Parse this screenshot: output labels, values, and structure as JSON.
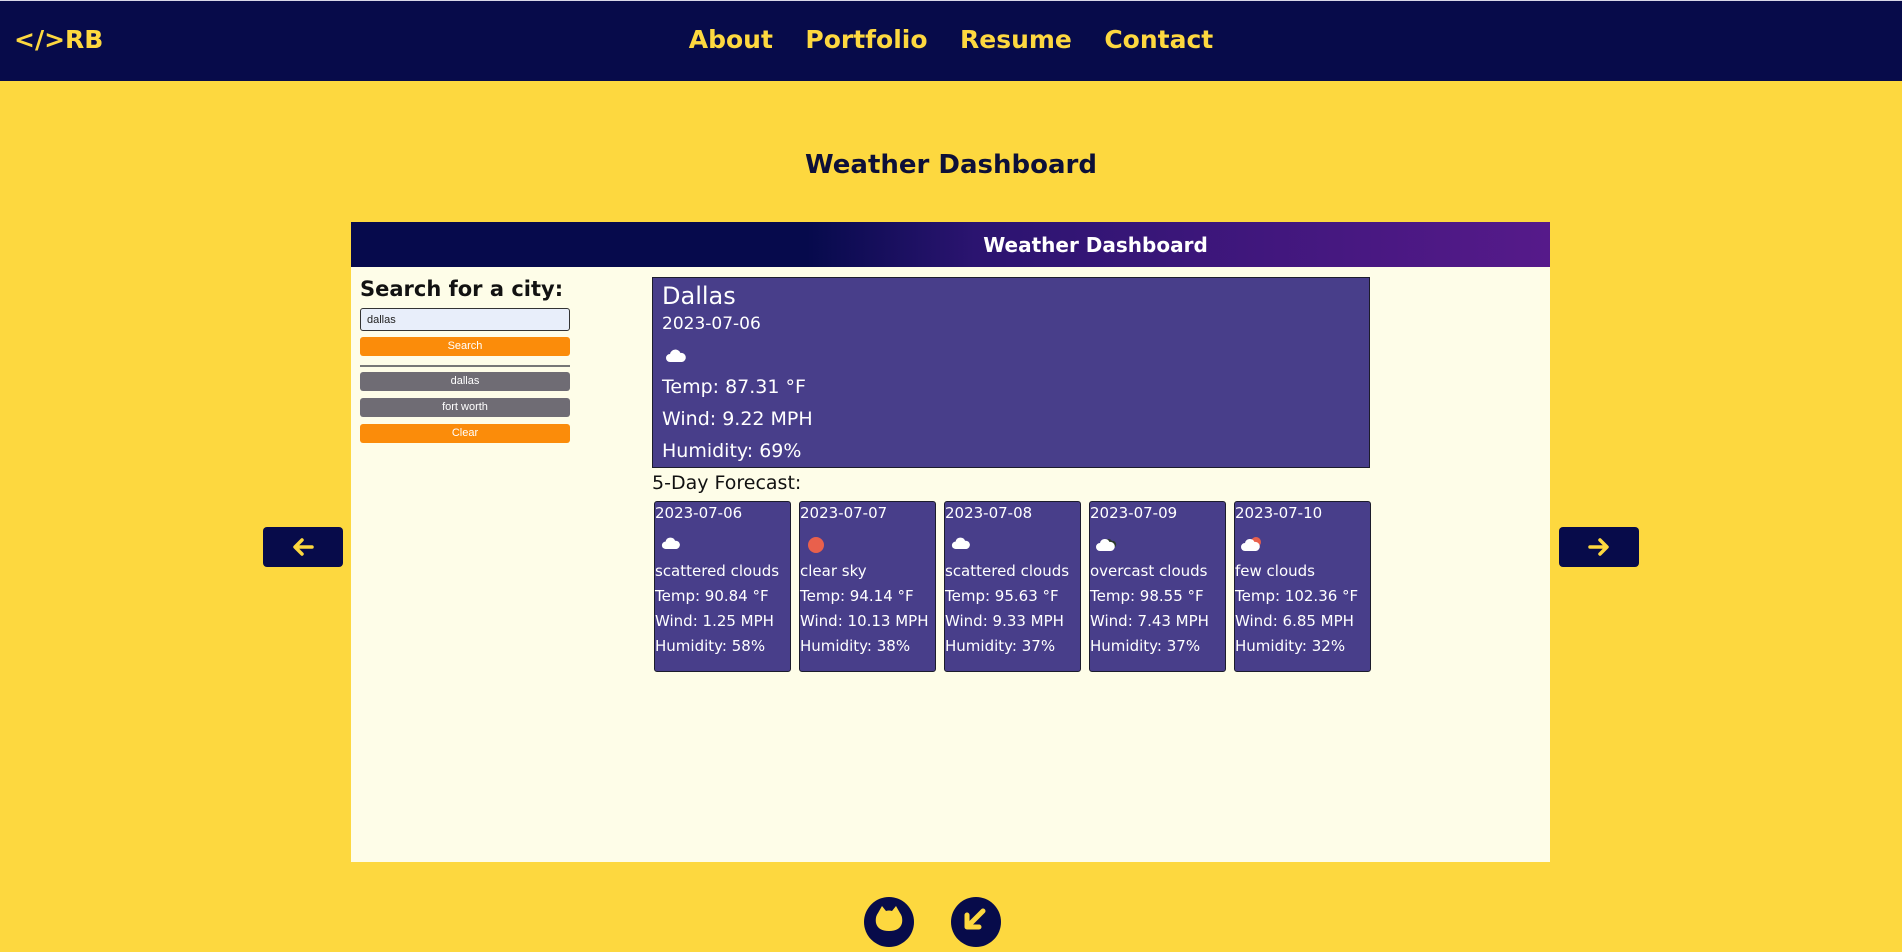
{
  "nav": {
    "logo": "</>RB",
    "links": [
      "About",
      "Portfolio",
      "Resume",
      "Contact"
    ]
  },
  "page_title": "Weather Dashboard",
  "dashboard": {
    "header_title": "Weather Dashboard",
    "search": {
      "label": "Search for a city:",
      "input_value": "dallas",
      "search_label": "Search"
    },
    "history": [
      "dallas",
      "fort worth"
    ],
    "clear_label": "Clear",
    "current": {
      "city": "Dallas",
      "date": "2023-07-06",
      "icon": "cloud-icon",
      "temp": "Temp: 87.31 °F",
      "wind": "Wind: 9.22 MPH",
      "humidity": "Humidity: 69%"
    },
    "forecast_label": "5-Day Forecast:",
    "forecast": [
      {
        "date": "2023-07-06",
        "icon": "cloud-icon",
        "desc": "scattered clouds",
        "temp": "Temp: 90.84 °F",
        "wind": "Wind: 1.25 MPH",
        "humidity": "Humidity: 58%"
      },
      {
        "date": "2023-07-07",
        "icon": "sun-icon",
        "desc": "clear sky",
        "temp": "Temp: 94.14 °F",
        "wind": "Wind: 10.13 MPH",
        "humidity": "Humidity: 38%"
      },
      {
        "date": "2023-07-08",
        "icon": "cloud-icon",
        "desc": "scattered clouds",
        "temp": "Temp: 95.63 °F",
        "wind": "Wind: 9.33 MPH",
        "humidity": "Humidity: 37%"
      },
      {
        "date": "2023-07-09",
        "icon": "overcast-cloud-icon",
        "desc": "overcast clouds",
        "temp": "Temp: 98.55 °F",
        "wind": "Wind: 7.43 MPH",
        "humidity": "Humidity: 37%"
      },
      {
        "date": "2023-07-10",
        "icon": "sun-cloud-icon",
        "desc": "few clouds",
        "temp": "Temp: 102.36 °F",
        "wind": "Wind: 6.85 MPH",
        "humidity": "Humidity: 32%"
      }
    ]
  },
  "carousel": {
    "prev_icon": "arrow-left-icon",
    "next_icon": "arrow-right-icon"
  },
  "footer": {
    "icons": [
      "github-icon",
      "arrow-down-left-icon"
    ]
  },
  "colors": {
    "background": "#fdd83f",
    "nav": "#070b4a",
    "accent": "#fdd83f",
    "card": "#483e8a",
    "orange_button": "#fb8c0a",
    "gray_button": "#6f6c74"
  }
}
